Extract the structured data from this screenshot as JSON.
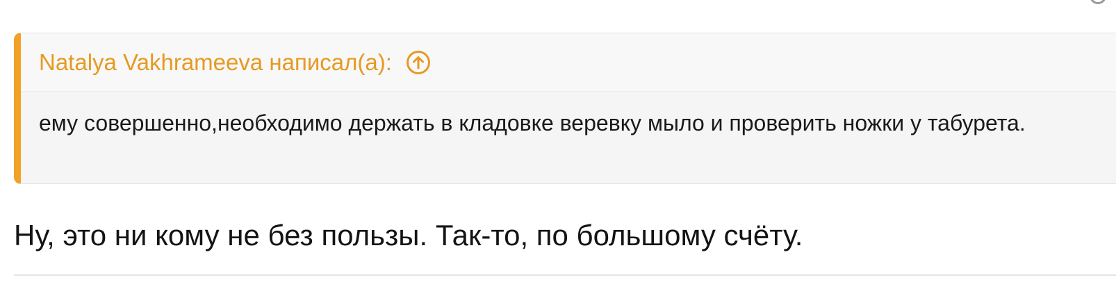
{
  "quote": {
    "author_line": "Natalya Vakhrameeva написал(а):",
    "jump_icon": "arrow-up-circle-icon",
    "text": "ему совершенно,необходимо держать в кладовке веревку мыло и проверить ножки у табурета."
  },
  "post": {
    "text": "Ну, это ни кому не без пользы. Так-то, по большому счёту."
  },
  "colors": {
    "accent": "#f0a126",
    "author": "#e69a22",
    "quote_bg": "#f5f5f5"
  }
}
